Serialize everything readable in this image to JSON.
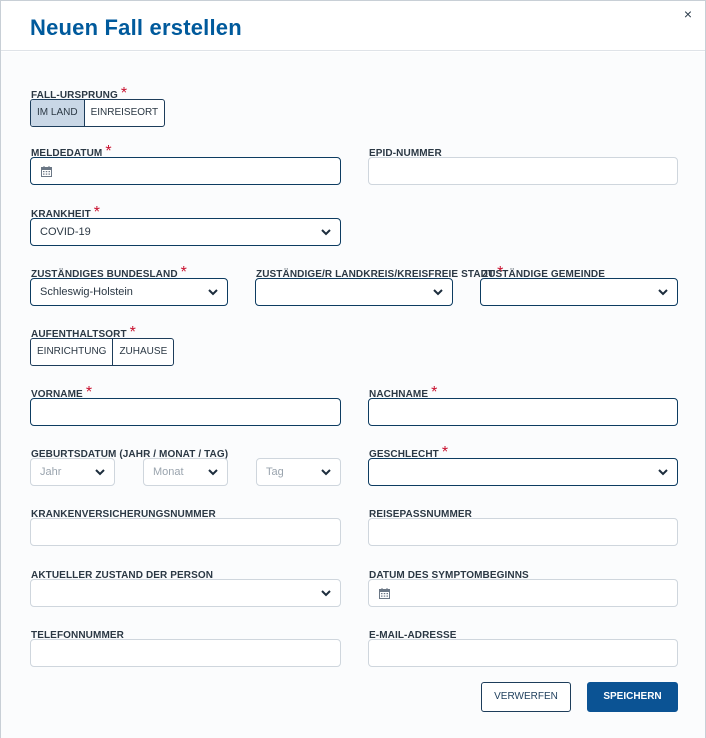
{
  "dialog": {
    "title": "Neuen Fall erstellen",
    "close_symbol": "×"
  },
  "form": {
    "fall_ursprung": {
      "label": "FALL-URSPRUNG",
      "options": [
        "IM LAND",
        "EINREISEORT"
      ],
      "selected": "IM LAND"
    },
    "meldedatum": {
      "label": "MELDEDATUM",
      "value": ""
    },
    "epid_nummer": {
      "label": "EPID-NUMMER",
      "value": ""
    },
    "krankheit": {
      "label": "KRANKHEIT",
      "value": "COVID-19"
    },
    "bundesland": {
      "label": "ZUSTÄNDIGES BUNDESLAND",
      "value": "Schleswig-Holstein"
    },
    "landkreis": {
      "label": "ZUSTÄNDIGE/R LANDKREIS/KREISFREIE STADT",
      "value": ""
    },
    "gemeinde": {
      "label": "ZUSTÄNDIGE GEMEINDE",
      "value": ""
    },
    "aufenthaltsort": {
      "label": "AUFENTHALTSORT",
      "options": [
        "EINRICHTUNG",
        "ZUHAUSE"
      ]
    },
    "vorname": {
      "label": "VORNAME",
      "value": ""
    },
    "nachname": {
      "label": "NACHNAME",
      "value": ""
    },
    "geburtsdatum": {
      "label": "GEBURTSDATUM (JAHR / MONAT / TAG)",
      "jahr_placeholder": "Jahr",
      "monat_placeholder": "Monat",
      "tag_placeholder": "Tag"
    },
    "geschlecht": {
      "label": "GESCHLECHT",
      "value": ""
    },
    "krankenversicherungsnummer": {
      "label": "KRANKENVERSICHERUNGSNUMMER",
      "value": ""
    },
    "reisepassnummer": {
      "label": "REISEPASSNUMMER",
      "value": ""
    },
    "zustand": {
      "label": "AKTUELLER ZUSTAND DER PERSON",
      "value": ""
    },
    "symptombeginn": {
      "label": "DATUM DES SYMPTOMBEGINNS",
      "value": ""
    },
    "telefonnummer": {
      "label": "TELEFONNUMMER",
      "value": ""
    },
    "email": {
      "label": "E-MAIL-ADRESSE",
      "value": ""
    },
    "required_marker": "*"
  },
  "footer": {
    "discard_label": "VERWERFEN",
    "save_label": "SPEICHERN"
  },
  "icons": {
    "close": "close-icon",
    "calendar": "calendar-icon",
    "dropdown": "chevron-down-icon"
  },
  "colors": {
    "title": "#005a9c",
    "required": "#c8102e",
    "primary_button": "#0b5394",
    "active_toggle": "#c9d7e6",
    "dark_border": "#0d3c61"
  }
}
